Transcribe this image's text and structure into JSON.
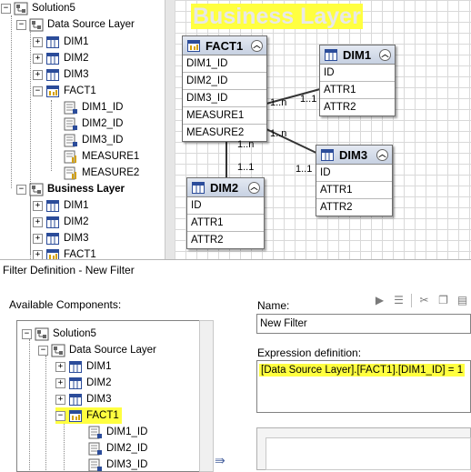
{
  "top_tree": {
    "items": [
      {
        "label": "Solution5",
        "type": "solution",
        "level": 0
      },
      {
        "label": "Data Source Layer",
        "type": "layer",
        "level": 1
      },
      {
        "label": "DIM1",
        "type": "table",
        "level": 2
      },
      {
        "label": "DIM2",
        "type": "table",
        "level": 2
      },
      {
        "label": "DIM3",
        "type": "table",
        "level": 2
      },
      {
        "label": "FACT1",
        "type": "fact",
        "level": 2
      },
      {
        "label": "DIM1_ID",
        "type": "column",
        "level": 3
      },
      {
        "label": "DIM2_ID",
        "type": "column",
        "level": 3
      },
      {
        "label": "DIM3_ID",
        "type": "column",
        "level": 3
      },
      {
        "label": "MEASURE1",
        "type": "measure",
        "level": 3
      },
      {
        "label": "MEASURE2",
        "type": "measure",
        "level": 3
      },
      {
        "label": "Business Layer",
        "type": "layer",
        "level": 1
      },
      {
        "label": "DIM1",
        "type": "table",
        "level": 2
      },
      {
        "label": "DIM2",
        "type": "table",
        "level": 2
      },
      {
        "label": "DIM3",
        "type": "table",
        "level": 2
      },
      {
        "label": "FACT1",
        "type": "fact",
        "level": 2
      }
    ]
  },
  "diagram": {
    "layer_title": "Business Layer",
    "entities": {
      "fact1": {
        "name": "FACT1",
        "fields": [
          "DIM1_ID",
          "DIM2_ID",
          "DIM3_ID",
          "MEASURE1",
          "MEASURE2"
        ]
      },
      "dim1": {
        "name": "DIM1",
        "fields": [
          "ID",
          "ATTR1",
          "ATTR2"
        ]
      },
      "dim2": {
        "name": "DIM2",
        "fields": [
          "ID",
          "ATTR1",
          "ATTR2"
        ]
      },
      "dim3": {
        "name": "DIM3",
        "fields": [
          "ID",
          "ATTR1",
          "ATTR2"
        ]
      }
    },
    "cardinality": {
      "fact_dim1_many": "1..n",
      "fact_dim1_one": "1..1",
      "fact_dim3_many": "1..n",
      "fact_dim3_one": "1..1",
      "fact_dim2_many": "1..n",
      "fact_dim2_one": "1..1"
    }
  },
  "dialog": {
    "title": "Filter Definition - New Filter",
    "available_components_label": "Available Components:",
    "tree": [
      {
        "label": "Solution5",
        "level": 0
      },
      {
        "label": "Data Source Layer",
        "level": 1
      },
      {
        "label": "DIM1",
        "level": 2
      },
      {
        "label": "DIM2",
        "level": 2
      },
      {
        "label": "DIM3",
        "level": 2
      },
      {
        "label": "FACT1",
        "level": 2
      },
      {
        "label": "DIM1_ID",
        "level": 3
      },
      {
        "label": "DIM2_ID",
        "level": 3
      },
      {
        "label": "DIM3_ID",
        "level": 3
      }
    ],
    "name_label": "Name:",
    "name_value": "New Filter",
    "expression_label": "Expression definition:",
    "expression_value": "[Data Source Layer].[FACT1].[DIM1_ID] = 1",
    "insert_arrow": "⇛",
    "toolbar_icons": [
      "play-icon",
      "list-icon",
      "cut-icon",
      "copy-icon",
      "paste-icon"
    ]
  },
  "colors": {
    "highlight": "#ffff40",
    "entity_header": "#c7d1e2",
    "icon_blue": "#2b4c9a"
  }
}
